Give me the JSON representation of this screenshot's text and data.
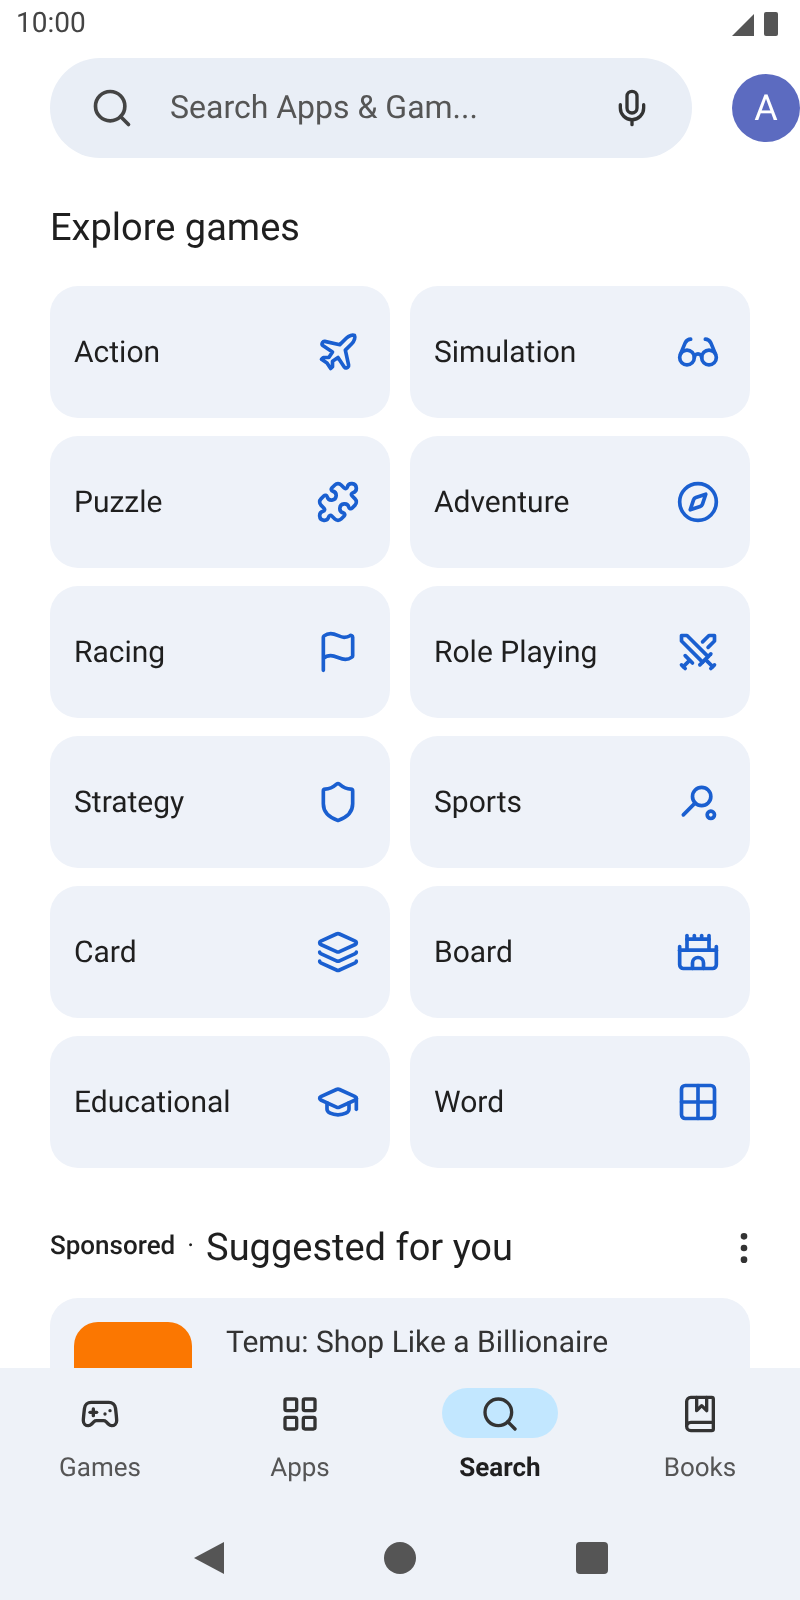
{
  "status_bar": {
    "time": "10:00"
  },
  "search": {
    "placeholder": "Search Apps & Gam...",
    "avatar": "A"
  },
  "section_title": "Explore games",
  "categories": [
    {
      "label": "Action"
    },
    {
      "label": "Simulation"
    },
    {
      "label": "Puzzle"
    },
    {
      "label": "Adventure"
    },
    {
      "label": "Racing"
    },
    {
      "label": "Role Playing"
    },
    {
      "label": "Strategy"
    },
    {
      "label": "Sports"
    },
    {
      "label": "Card"
    },
    {
      "label": "Board"
    },
    {
      "label": "Educational"
    },
    {
      "label": "Word"
    }
  ],
  "suggested": {
    "sponsored": "Sponsored",
    "separator": "·",
    "title": "Suggested for you",
    "app_title": "Temu: Shop Like a Billionaire"
  },
  "bottom_nav": [
    {
      "label": "Games",
      "selected": false
    },
    {
      "label": "Apps",
      "selected": false
    },
    {
      "label": "Search",
      "selected": true
    },
    {
      "label": "Books",
      "selected": false
    }
  ]
}
